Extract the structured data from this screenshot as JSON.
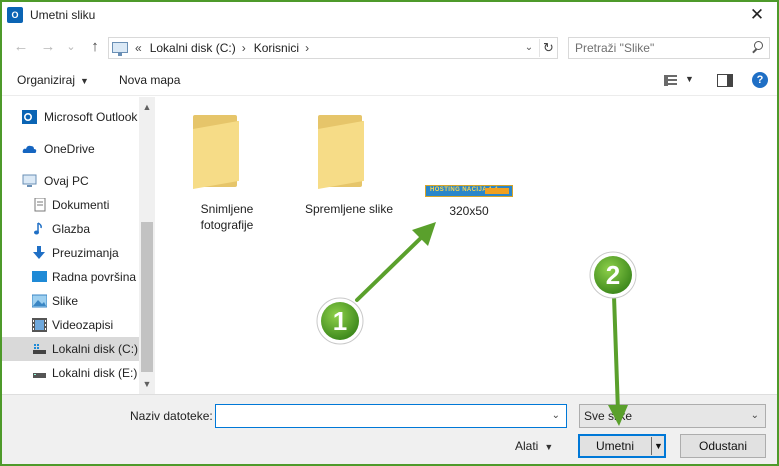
{
  "window": {
    "title": "Umetni sliku",
    "app_icon": "outlook-icon",
    "close_glyph": "✕"
  },
  "nav": {
    "back_glyph": "←",
    "forward_glyph": "→",
    "recent_glyph": "⌄",
    "up_glyph": "↑",
    "breadcrumb": [
      "«",
      "Lokalni disk (C:)",
      "›",
      "Korisnici",
      "›"
    ],
    "search_placeholder": "Pretraži \"Slike\""
  },
  "toolbar": {
    "organize_label": "Organiziraj",
    "new_folder_label": "Nova mapa"
  },
  "sidebar": {
    "items": [
      {
        "label": "Microsoft Outlook",
        "icon": "outlook-icon"
      },
      {
        "label": "OneDrive",
        "icon": "onedrive-icon"
      },
      {
        "label": "Ovaj PC",
        "icon": "computer-icon"
      },
      {
        "label": "Dokumenti",
        "icon": "documents-icon"
      },
      {
        "label": "Glazba",
        "icon": "music-icon"
      },
      {
        "label": "Preuzimanja",
        "icon": "download-icon"
      },
      {
        "label": "Radna površina",
        "icon": "desktop-icon"
      },
      {
        "label": "Slike",
        "icon": "pictures-icon"
      },
      {
        "label": "Videozapisi",
        "icon": "videos-icon"
      },
      {
        "label": "Lokalni disk (C:)",
        "icon": "drive-icon",
        "selected": true
      },
      {
        "label": "Lokalni disk (E:)",
        "icon": "drive-icon"
      }
    ]
  },
  "content": {
    "items": [
      {
        "type": "folder",
        "label_line1": "Snimljene",
        "label_line2": "fotografije"
      },
      {
        "type": "folder",
        "label": "Spremljene slike"
      },
      {
        "type": "image",
        "label": "320x50",
        "thumb_text": "HOSTING NACIJA 1-1",
        "thumb_color": "#2a86c9",
        "thumb_accent": "#f0a020"
      }
    ]
  },
  "bottom": {
    "filename_label": "Naziv datoteke:",
    "filename_value": "",
    "filetype_value": "Sve slike",
    "tools_label": "Alati",
    "insert_label": "Umetni",
    "cancel_label": "Odustani"
  },
  "annotations": {
    "color": "#5aa02c",
    "badges": [
      "1",
      "2"
    ]
  }
}
